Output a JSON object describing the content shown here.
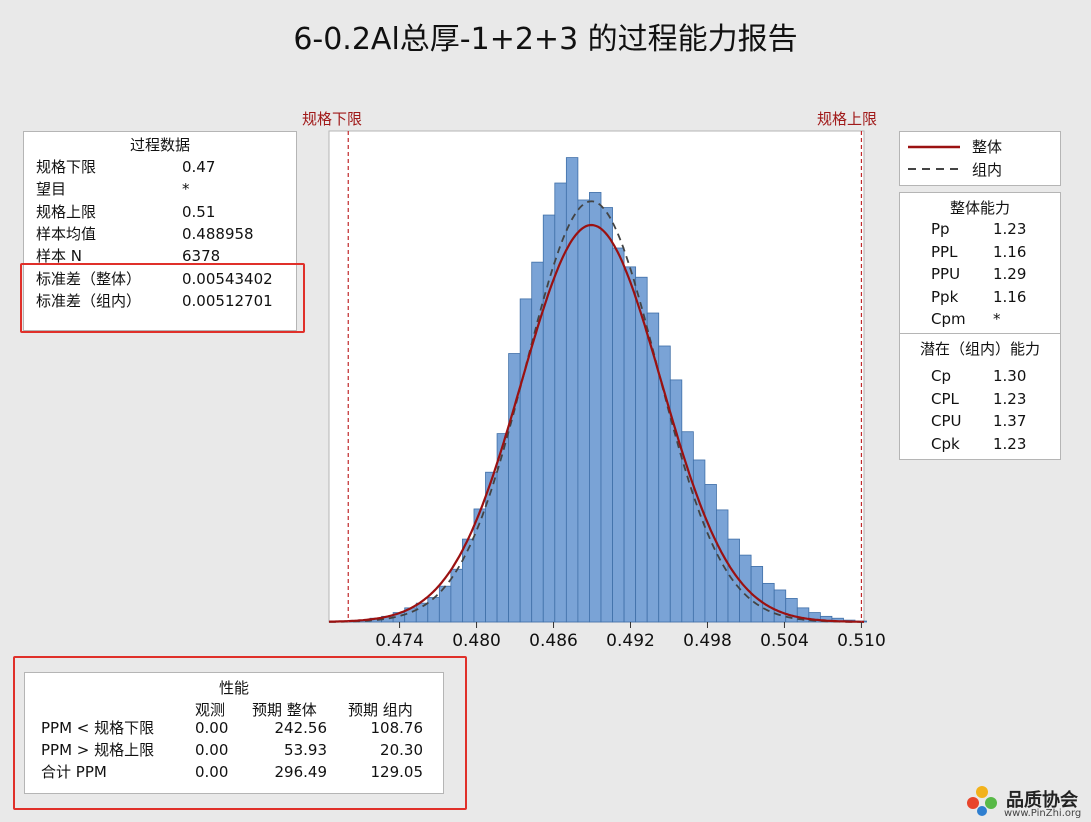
{
  "title": "6-0.2Al总厚-1+2+3 的过程能力报告",
  "spec_labels": {
    "lsl": "规格下限",
    "usl": "规格上限"
  },
  "process_data": {
    "header": "过程数据",
    "rows": [
      {
        "label": "规格下限",
        "value": "0.47"
      },
      {
        "label": "望目",
        "value": "*"
      },
      {
        "label": "规格上限",
        "value": "0.51"
      },
      {
        "label": "样本均值",
        "value": "0.488958"
      },
      {
        "label": "样本 N",
        "value": "6378"
      },
      {
        "label": "标准差（整体）",
        "value": "0.00543402"
      },
      {
        "label": "标准差（组内）",
        "value": "0.00512701"
      }
    ]
  },
  "legend": {
    "overall": "整体",
    "within": "组内"
  },
  "overall_capability": {
    "header": "整体能力",
    "rows": [
      {
        "label": "Pp",
        "value": "1.23"
      },
      {
        "label": "PPL",
        "value": "1.16"
      },
      {
        "label": "PPU",
        "value": "1.29"
      },
      {
        "label": "Ppk",
        "value": "1.16"
      },
      {
        "label": "Cpm",
        "value": "*"
      }
    ]
  },
  "potential_capability": {
    "header": "潜在（组内）能力",
    "rows": [
      {
        "label": "Cp",
        "value": "1.30"
      },
      {
        "label": "CPL",
        "value": "1.23"
      },
      {
        "label": "CPU",
        "value": "1.37"
      },
      {
        "label": "Cpk",
        "value": "1.23"
      }
    ]
  },
  "performance": {
    "header": "性能",
    "columns": [
      "",
      "观测",
      "预期 整体",
      "预期 组内"
    ],
    "rows": [
      {
        "label": "PPM < 规格下限",
        "observed": "0.00",
        "exp_overall": "242.56",
        "exp_within": "108.76"
      },
      {
        "label": "PPM > 规格上限",
        "observed": "0.00",
        "exp_overall": "53.93",
        "exp_within": "20.30"
      },
      {
        "label": "合计 PPM",
        "observed": "0.00",
        "exp_overall": "296.49",
        "exp_within": "129.05"
      }
    ]
  },
  "logo": {
    "name": "品质协会",
    "url": "www.PinZhi.org"
  },
  "colors": {
    "bar": "#7aa3d6",
    "bar_edge": "#3f6fa8",
    "overall_curve": "#9b1111",
    "within_curve": "#444444",
    "spec_line": "#c0282a",
    "highlight": "#e0302a"
  },
  "chart_data": {
    "type": "bar",
    "subtype": "histogram",
    "xlim": [
      0.4685,
      0.5102
    ],
    "xticks": [
      0.474,
      0.48,
      0.486,
      0.492,
      0.498,
      0.504,
      0.51
    ],
    "xtick_labels": [
      "0.474",
      "0.480",
      "0.486",
      "0.492",
      "0.498",
      "0.504",
      "0.510"
    ],
    "bin_start": 0.4699,
    "bin_width": 0.0009,
    "counts": [
      1,
      2,
      4,
      6,
      10,
      15,
      20,
      26,
      38,
      56,
      88,
      120,
      159,
      200,
      285,
      343,
      382,
      432,
      466,
      493,
      448,
      456,
      440,
      397,
      377,
      366,
      328,
      293,
      257,
      202,
      172,
      146,
      119,
      88,
      71,
      59,
      41,
      34,
      25,
      15,
      10,
      6,
      4,
      2,
      1,
      0,
      0,
      0
    ],
    "ylim_count": [
      0,
      500
    ],
    "lsl": 0.47,
    "usl": 0.51,
    "mean": 0.488958,
    "sd_overall": 0.00543402,
    "sd_within": 0.00512701,
    "n": 6378
  }
}
